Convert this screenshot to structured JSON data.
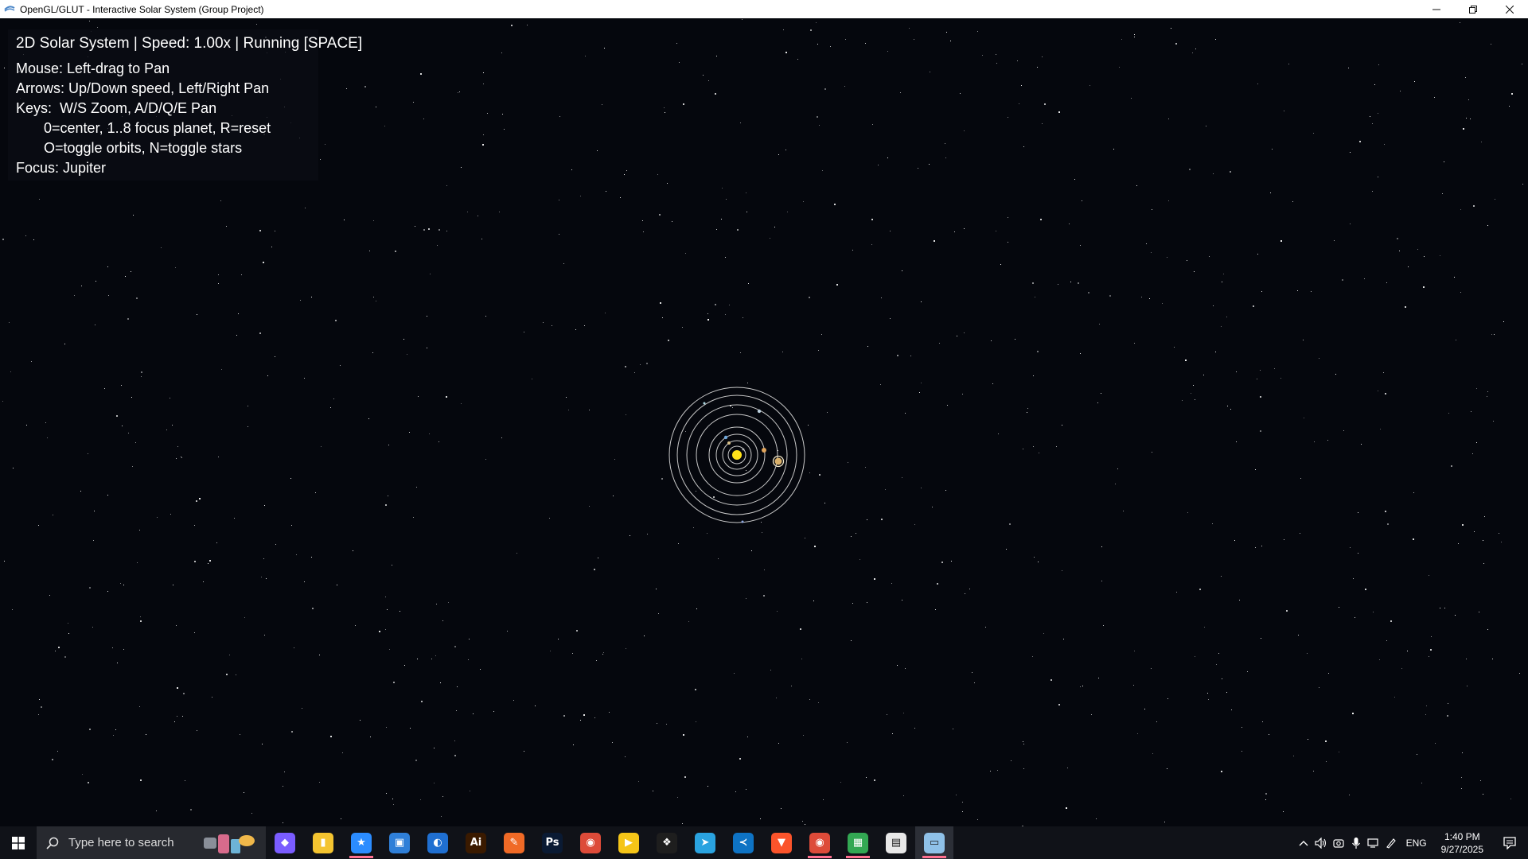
{
  "window": {
    "title": "OpenGL/GLUT - Interactive Solar System (Group Project)",
    "minimize_icon": "minimize-icon",
    "restore_icon": "restore-icon",
    "close_icon": "close-icon"
  },
  "hud": {
    "status": "2D Solar System | Speed: 1.00x | Running [SPACE]",
    "mouse_help": "Mouse: Left-drag to Pan",
    "arrows_help": "Arrows: Up/Down speed, Left/Right Pan",
    "keys_help": "Keys:  W/S Zoom, A/D/Q/E Pan",
    "keys_help_2": "       0=center, 1..8 focus planet, R=reset",
    "keys_help_3": "       O=toggle orbits, N=toggle stars",
    "focus": "Focus: Jupiter"
  },
  "scene": {
    "background_color": "#05070d",
    "sun_color": "#ffe21a",
    "orbit_color": "#c9c9c9",
    "focused_planet": "Jupiter",
    "star_count": 900
  },
  "taskbar": {
    "search_placeholder": "Type here to search",
    "apps": [
      {
        "name": "copilot-icon",
        "color": "#7a5cff",
        "glyph": "◆"
      },
      {
        "name": "file-manager-icon",
        "color": "#f4c430",
        "glyph": "▮"
      },
      {
        "name": "starred-app-icon",
        "color": "#2b8cff",
        "glyph": "★"
      },
      {
        "name": "windows-explorer-icon",
        "color": "#2f7fd8",
        "glyph": "▣"
      },
      {
        "name": "edge-browser-icon",
        "color": "#1f6fd1",
        "glyph": "◐"
      },
      {
        "name": "illustrator-icon",
        "color": "#3a1a00",
        "glyph": "Ai"
      },
      {
        "name": "pencil-app-icon",
        "color": "#f06a26",
        "glyph": "✎"
      },
      {
        "name": "photoshop-icon",
        "color": "#0a1a33",
        "glyph": "Ps"
      },
      {
        "name": "chrome-icon",
        "color": "#dd4b39",
        "glyph": "◉"
      },
      {
        "name": "player-app-icon",
        "color": "#f5c518",
        "glyph": "▶"
      },
      {
        "name": "figma-icon",
        "color": "#1e1e1e",
        "glyph": "❖"
      },
      {
        "name": "telegram-icon",
        "color": "#2aa3e0",
        "glyph": "➤"
      },
      {
        "name": "vscode-icon",
        "color": "#0e73c4",
        "glyph": "≺"
      },
      {
        "name": "brave-browser-icon",
        "color": "#fb542b",
        "glyph": "▼"
      },
      {
        "name": "chrome-profile-icon",
        "color": "#dd4b39",
        "glyph": "◉"
      },
      {
        "name": "microsoft-store-icon",
        "color": "#33a853",
        "glyph": "▦"
      },
      {
        "name": "notepad-window-icon",
        "color": "#e8e8e8",
        "glyph": "▤"
      },
      {
        "name": "opengl-app-icon",
        "color": "#8fc1e8",
        "glyph": "▭"
      }
    ],
    "tray": {
      "language": "ENG",
      "time": "1:40 PM",
      "date": "9/27/2025"
    }
  }
}
